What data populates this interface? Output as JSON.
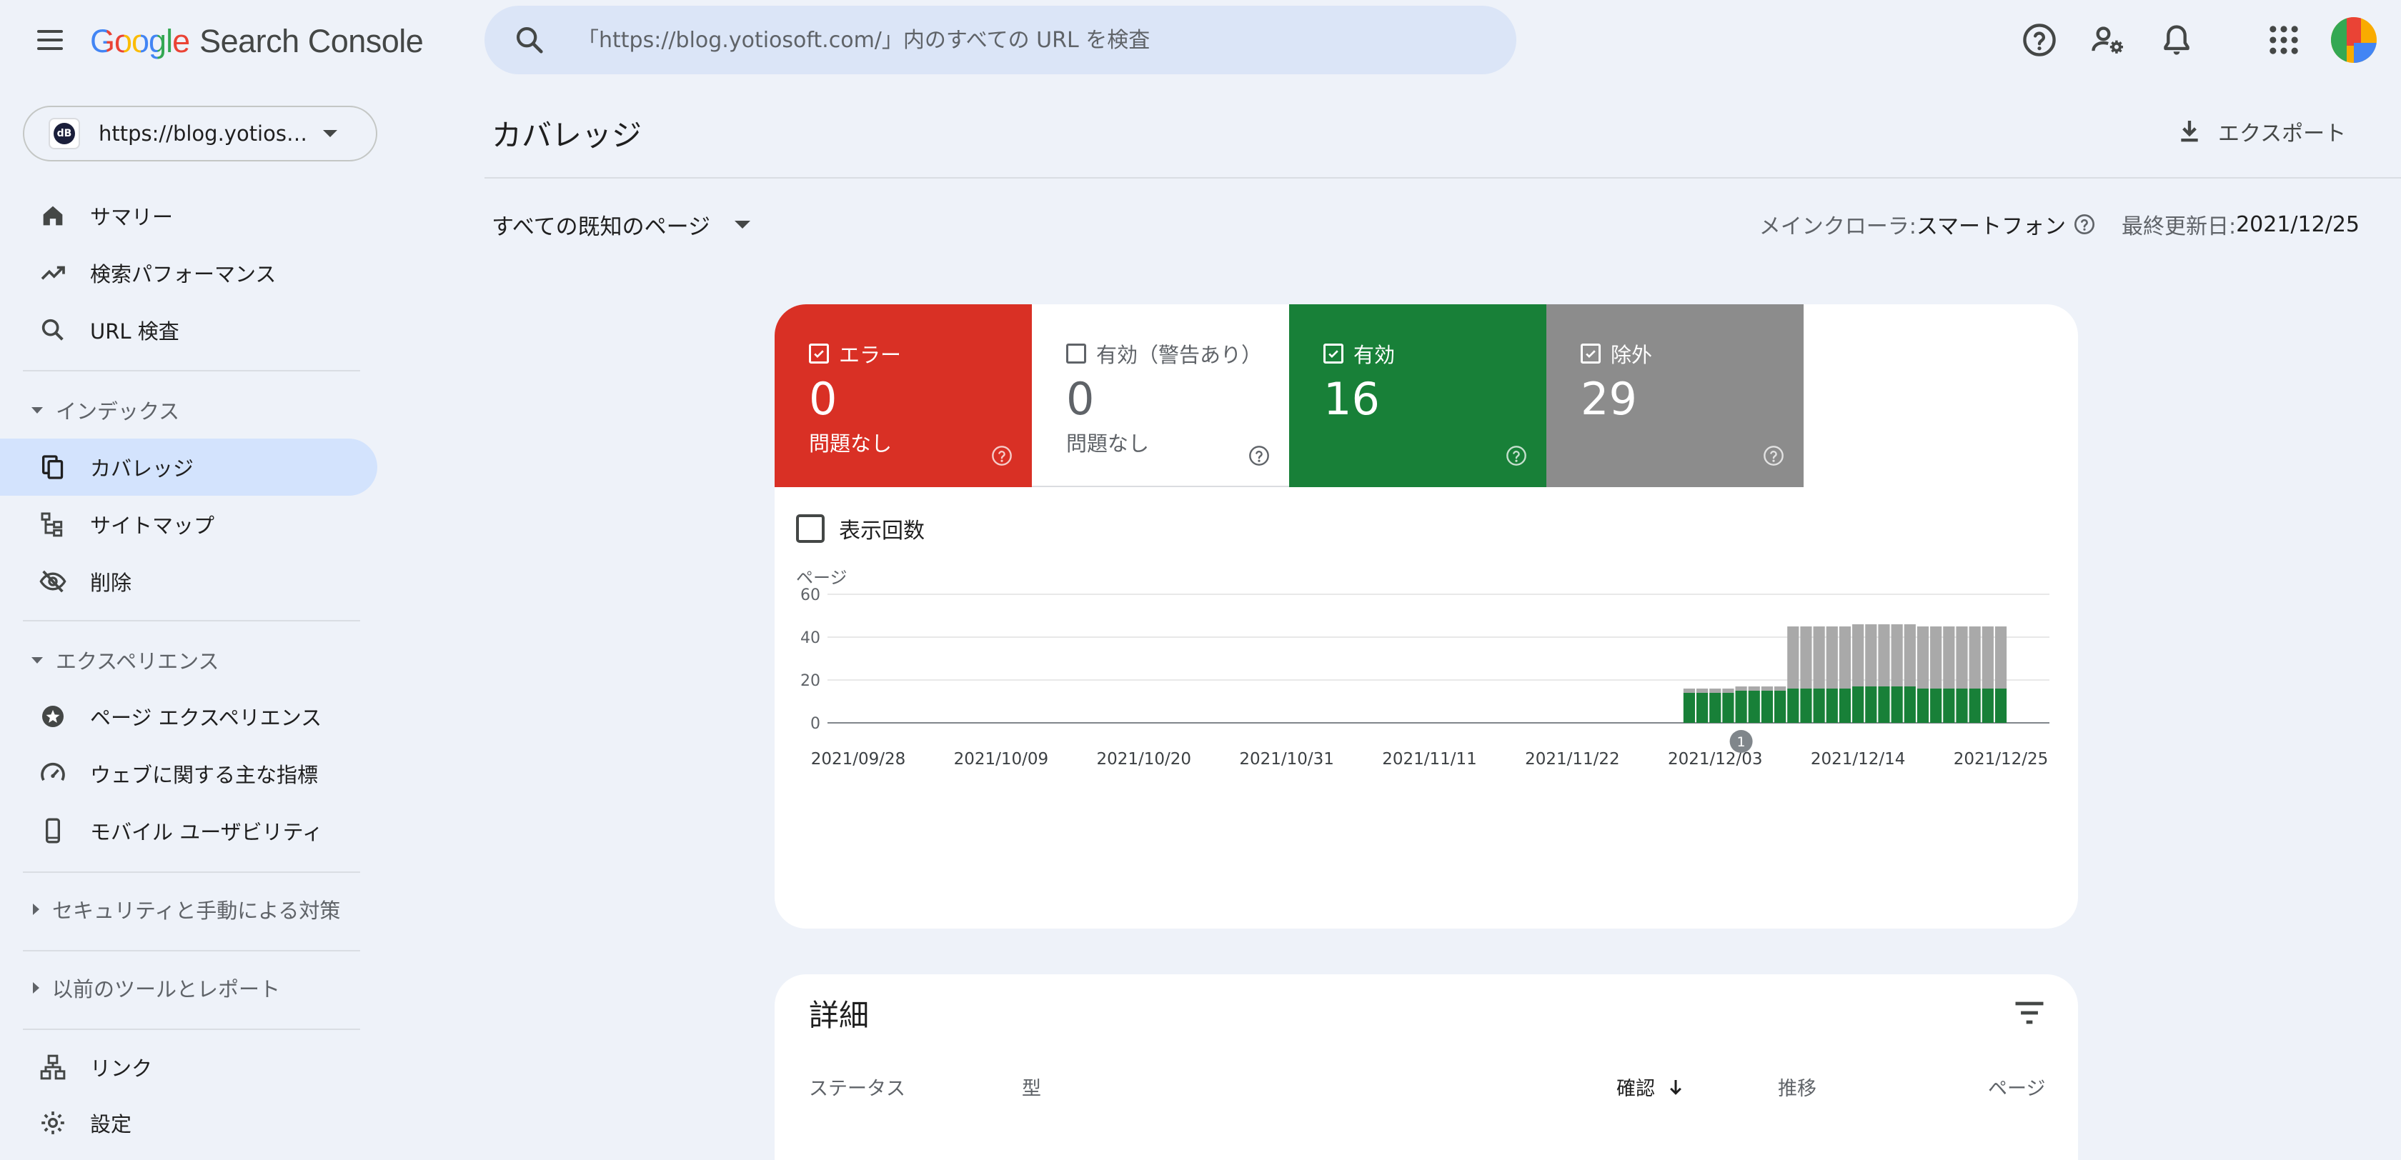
{
  "app": {
    "logo_word": "Google",
    "product": "Search Console"
  },
  "search": {
    "placeholder": "「https://blog.yotiosoft.com/」内のすべての URL を検査"
  },
  "property": {
    "url": "https://blog.yotiosoft.com/",
    "favicon_text": "dB"
  },
  "sidebar": {
    "items": [
      {
        "label": "サマリー",
        "icon": "home-icon"
      },
      {
        "label": "検索パフォーマンス",
        "icon": "trending-up-icon"
      },
      {
        "label": "URL 検査",
        "icon": "search-icon"
      }
    ],
    "index_section": {
      "label": "インデックス",
      "items": [
        {
          "label": "カバレッジ",
          "icon": "file-copy-icon",
          "active": true
        },
        {
          "label": "サイトマップ",
          "icon": "sitemap-icon"
        },
        {
          "label": "削除",
          "icon": "visibility-off-icon"
        }
      ]
    },
    "experience_section": {
      "label": "エクスペリエンス",
      "items": [
        {
          "label": "ページ エクスペリエンス",
          "icon": "page-experience-icon"
        },
        {
          "label": "ウェブに関する主な指標",
          "icon": "speed-gauge-icon"
        },
        {
          "label": "モバイル ユーザビリティ",
          "icon": "smartphone-icon"
        }
      ]
    },
    "security_section": {
      "label": "セキュリティと手動による対策"
    },
    "legacy_section": {
      "label": "以前のツールとレポート"
    },
    "links": {
      "label": "リンク",
      "icon": "links-icon"
    },
    "settings": {
      "label": "設定",
      "icon": "settings-icon"
    }
  },
  "header": {
    "title": "カバレッジ",
    "export_label": "エクスポート",
    "filter_label": "すべての既知のページ",
    "crawler_label": "メインクローラ: ",
    "crawler_value": "スマートフォン",
    "updated_label": "最終更新日: ",
    "updated_value": "2021/12/25"
  },
  "tiles": [
    {
      "label": "エラー",
      "count": "0",
      "sub": "問題なし",
      "checked": true,
      "bg": "#d93025",
      "fg": "#ffffff"
    },
    {
      "label": "有効（警告あり）",
      "count": "0",
      "sub": "問題なし",
      "checked": false,
      "bg": "#ffffff",
      "fg": "#5f6368"
    },
    {
      "label": "有効",
      "count": "16",
      "sub": "",
      "checked": true,
      "bg": "#188038",
      "fg": "#ffffff"
    },
    {
      "label": "除外",
      "count": "29",
      "sub": "",
      "checked": true,
      "bg": "#8c8c8c",
      "fg": "#ffffff"
    }
  ],
  "impressions_toggle": {
    "label": "表示回数",
    "checked": false
  },
  "colors": {
    "accent": "#d3e3fd",
    "valid": "#188038",
    "excluded": "#a9a9a9",
    "error": "#d93025"
  },
  "chart_data": {
    "type": "bar",
    "stacked": true,
    "ylabel": "ページ",
    "ylim": [
      0,
      60
    ],
    "yticks": [
      0,
      20,
      40,
      60
    ],
    "xticks": [
      "2021/09/28",
      "2021/10/09",
      "2021/10/20",
      "2021/10/31",
      "2021/11/11",
      "2021/11/22",
      "2021/12/03",
      "2021/12/14",
      "2021/12/25"
    ],
    "annotation": {
      "label": "1",
      "date": "2021/12/05"
    },
    "x": [
      "2021/12/01",
      "2021/12/02",
      "2021/12/03",
      "2021/12/04",
      "2021/12/05",
      "2021/12/06",
      "2021/12/07",
      "2021/12/08",
      "2021/12/09",
      "2021/12/10",
      "2021/12/11",
      "2021/12/12",
      "2021/12/13",
      "2021/12/14",
      "2021/12/15",
      "2021/12/16",
      "2021/12/17",
      "2021/12/18",
      "2021/12/19",
      "2021/12/20",
      "2021/12/21",
      "2021/12/22",
      "2021/12/23",
      "2021/12/24",
      "2021/12/25"
    ],
    "series": [
      {
        "name": "有効",
        "color": "#188038",
        "values": [
          14,
          14,
          14,
          14,
          15,
          15,
          15,
          15,
          16,
          16,
          16,
          16,
          16,
          17,
          17,
          17,
          17,
          17,
          16,
          16,
          16,
          16,
          16,
          16,
          16
        ]
      },
      {
        "name": "除外",
        "color": "#a9a9a9",
        "values": [
          2,
          2,
          2,
          2,
          2,
          2,
          2,
          2,
          29,
          29,
          29,
          29,
          29,
          29,
          29,
          29,
          29,
          29,
          29,
          29,
          29,
          29,
          29,
          29,
          29
        ]
      }
    ]
  },
  "details": {
    "title": "詳細",
    "columns": [
      "ステータス",
      "型",
      "確認",
      "推移",
      "ページ"
    ]
  }
}
